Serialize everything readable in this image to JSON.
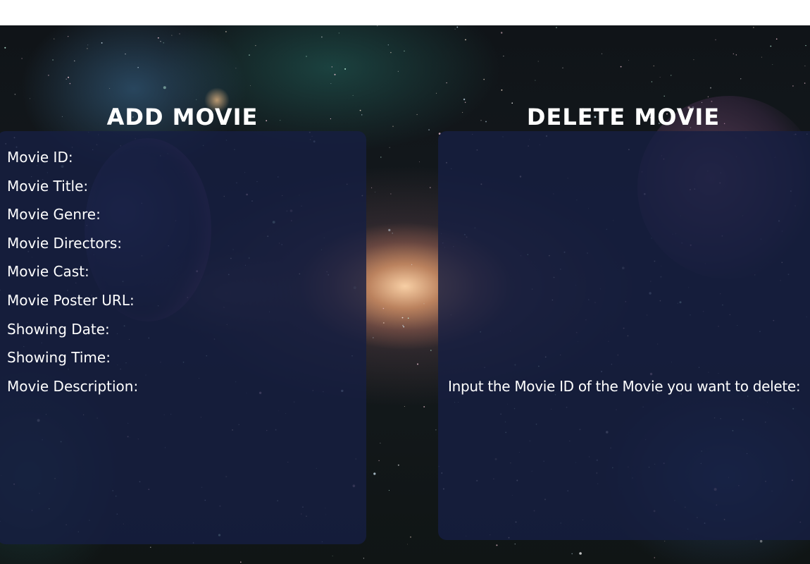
{
  "add_section": {
    "heading": "ADD MOVIE",
    "fields": [
      {
        "label": "Movie ID:"
      },
      {
        "label": "Movie Title:"
      },
      {
        "label": "Movie Genre:"
      },
      {
        "label": "Movie Directors:"
      },
      {
        "label": "Movie Cast:"
      },
      {
        "label": "Movie Poster URL:"
      },
      {
        "label": "Showing Date:"
      },
      {
        "label": "Showing Time:"
      },
      {
        "label": "Movie Description:"
      }
    ]
  },
  "delete_section": {
    "heading": "DELETE MOVIE",
    "prompt": "Input the Movie ID of the Movie you want to delete:"
  },
  "colors": {
    "panel": "#161e42",
    "text": "#ffffff",
    "galaxy_core": "#f2c8a0"
  }
}
